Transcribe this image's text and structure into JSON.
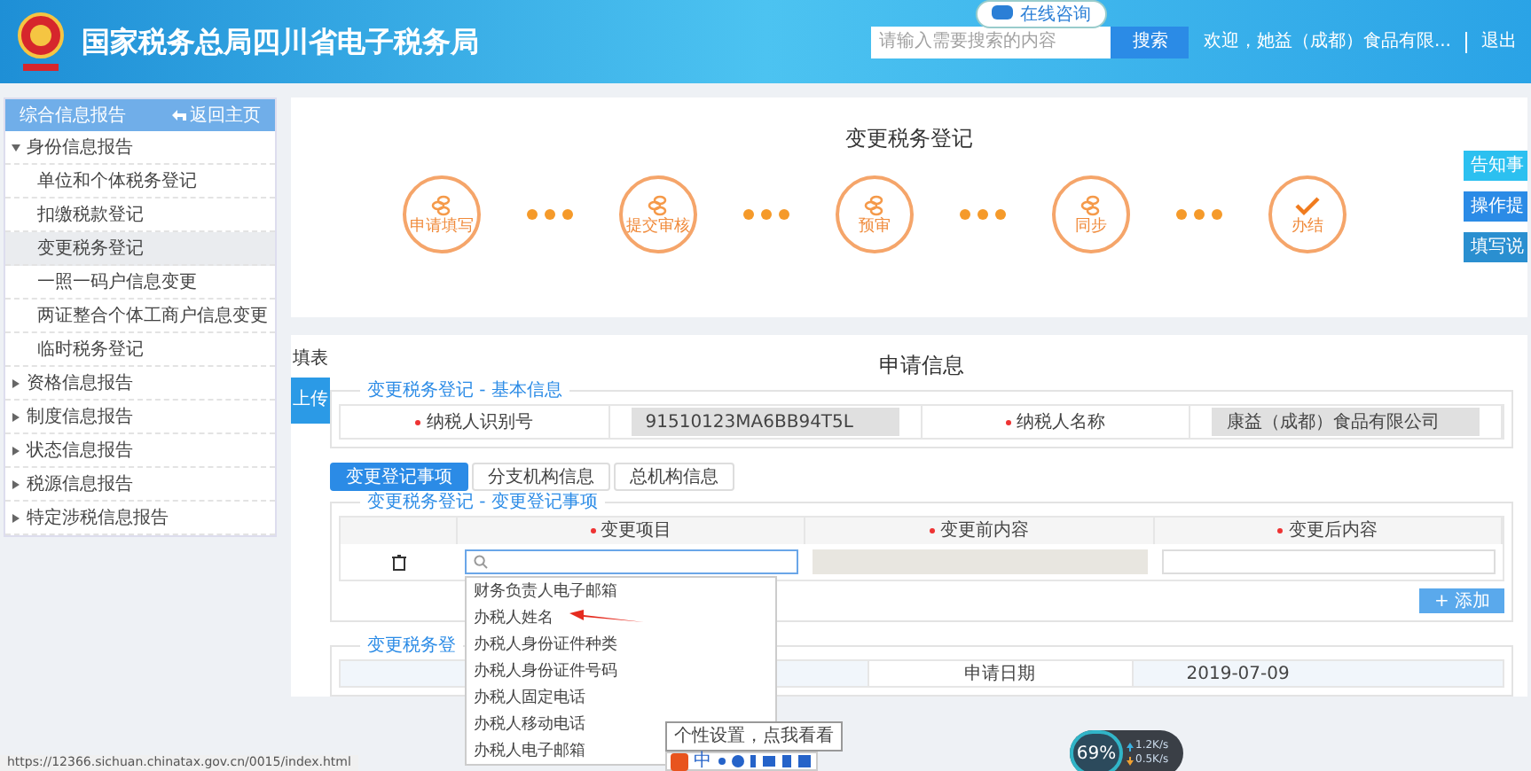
{
  "header": {
    "site_title": "国家税务总局四川省电子税务局",
    "online_help": "在线咨询",
    "search": {
      "placeholder": "请输入需要搜索的内容"
    },
    "search_button": "搜索",
    "welcome": "欢迎，她益（成都）食品有限...",
    "logout": "退出"
  },
  "sidebar": {
    "title": "综合信息报告",
    "back": "返回主页",
    "items": [
      {
        "label": "身份信息报告",
        "expanded": true,
        "children": [
          {
            "label": "单位和个体税务登记",
            "selected": false
          },
          {
            "label": "扣缴税款登记",
            "selected": false
          },
          {
            "label": "变更税务登记",
            "selected": true
          },
          {
            "label": "一照一码户信息变更",
            "selected": false
          },
          {
            "label": "两证整合个体工商户信息变更",
            "selected": false
          },
          {
            "label": "临时税务登记",
            "selected": false
          }
        ]
      },
      {
        "label": "资格信息报告",
        "expanded": false
      },
      {
        "label": "制度信息报告",
        "expanded": false
      },
      {
        "label": "状态信息报告",
        "expanded": false
      },
      {
        "label": "税源信息报告",
        "expanded": false
      },
      {
        "label": "特定涉税信息报告",
        "expanded": false
      }
    ]
  },
  "progress": {
    "title": "变更税务登记",
    "steps": [
      {
        "label": "申请填写",
        "kind": "pending"
      },
      {
        "label": "提交审核",
        "kind": "pending"
      },
      {
        "label": "预审",
        "kind": "pending"
      },
      {
        "label": "同步",
        "kind": "pending"
      },
      {
        "label": "办结",
        "kind": "done"
      }
    ]
  },
  "side_buttons": [
    {
      "label": "告知事"
    },
    {
      "label": "操作提"
    },
    {
      "label": "填写说"
    }
  ],
  "form": {
    "side_tabs": [
      {
        "label": "填表",
        "selected": false
      },
      {
        "label": "上传",
        "selected": true
      }
    ],
    "title": "申请信息",
    "basic": {
      "legend": "变更税务登记 - 基本信息",
      "fields": [
        {
          "label": "纳税人识别号",
          "required": true,
          "value": "91510123MA6BB94T5L"
        },
        {
          "label": "纳税人名称",
          "required": true,
          "value": "康益（成都）食品有限公司"
        }
      ]
    },
    "tabs": [
      {
        "label": "变更登记事项",
        "selected": true
      },
      {
        "label": "分支机构信息",
        "selected": false
      },
      {
        "label": "总机构信息",
        "selected": false
      }
    ],
    "changes": {
      "legend": "变更税务登记 - 变更登记事项",
      "columns": [
        {
          "label": "变更项目",
          "required": true
        },
        {
          "label": "变更前内容",
          "required": true
        },
        {
          "label": "变更后内容",
          "required": true
        }
      ],
      "add_button": "+ 添加"
    },
    "dropdown": {
      "options": [
        {
          "label": "财务负责人电子邮箱",
          "pointed": false
        },
        {
          "label": "办税人姓名",
          "pointed": true
        },
        {
          "label": "办税人身份证件种类",
          "pointed": false
        },
        {
          "label": "办税人身份证件号码",
          "pointed": false
        },
        {
          "label": "办税人固定电话",
          "pointed": false
        },
        {
          "label": "办税人移动电话",
          "pointed": false
        },
        {
          "label": "办税人电子邮箱",
          "pointed": false
        }
      ]
    },
    "other": {
      "legend": "变更税务登",
      "fields": [
        {
          "label": "申请日期",
          "value": "2019-07-09"
        }
      ]
    }
  },
  "overlays": {
    "tooltip": "个性设置，点我看看",
    "ime_label": "中",
    "meter": {
      "percent": "69%",
      "up": "1.2K/s",
      "down": "0.5K/s"
    },
    "status_url": "https://12366.sichuan.chinatax.gov.cn/0015/index.html"
  }
}
